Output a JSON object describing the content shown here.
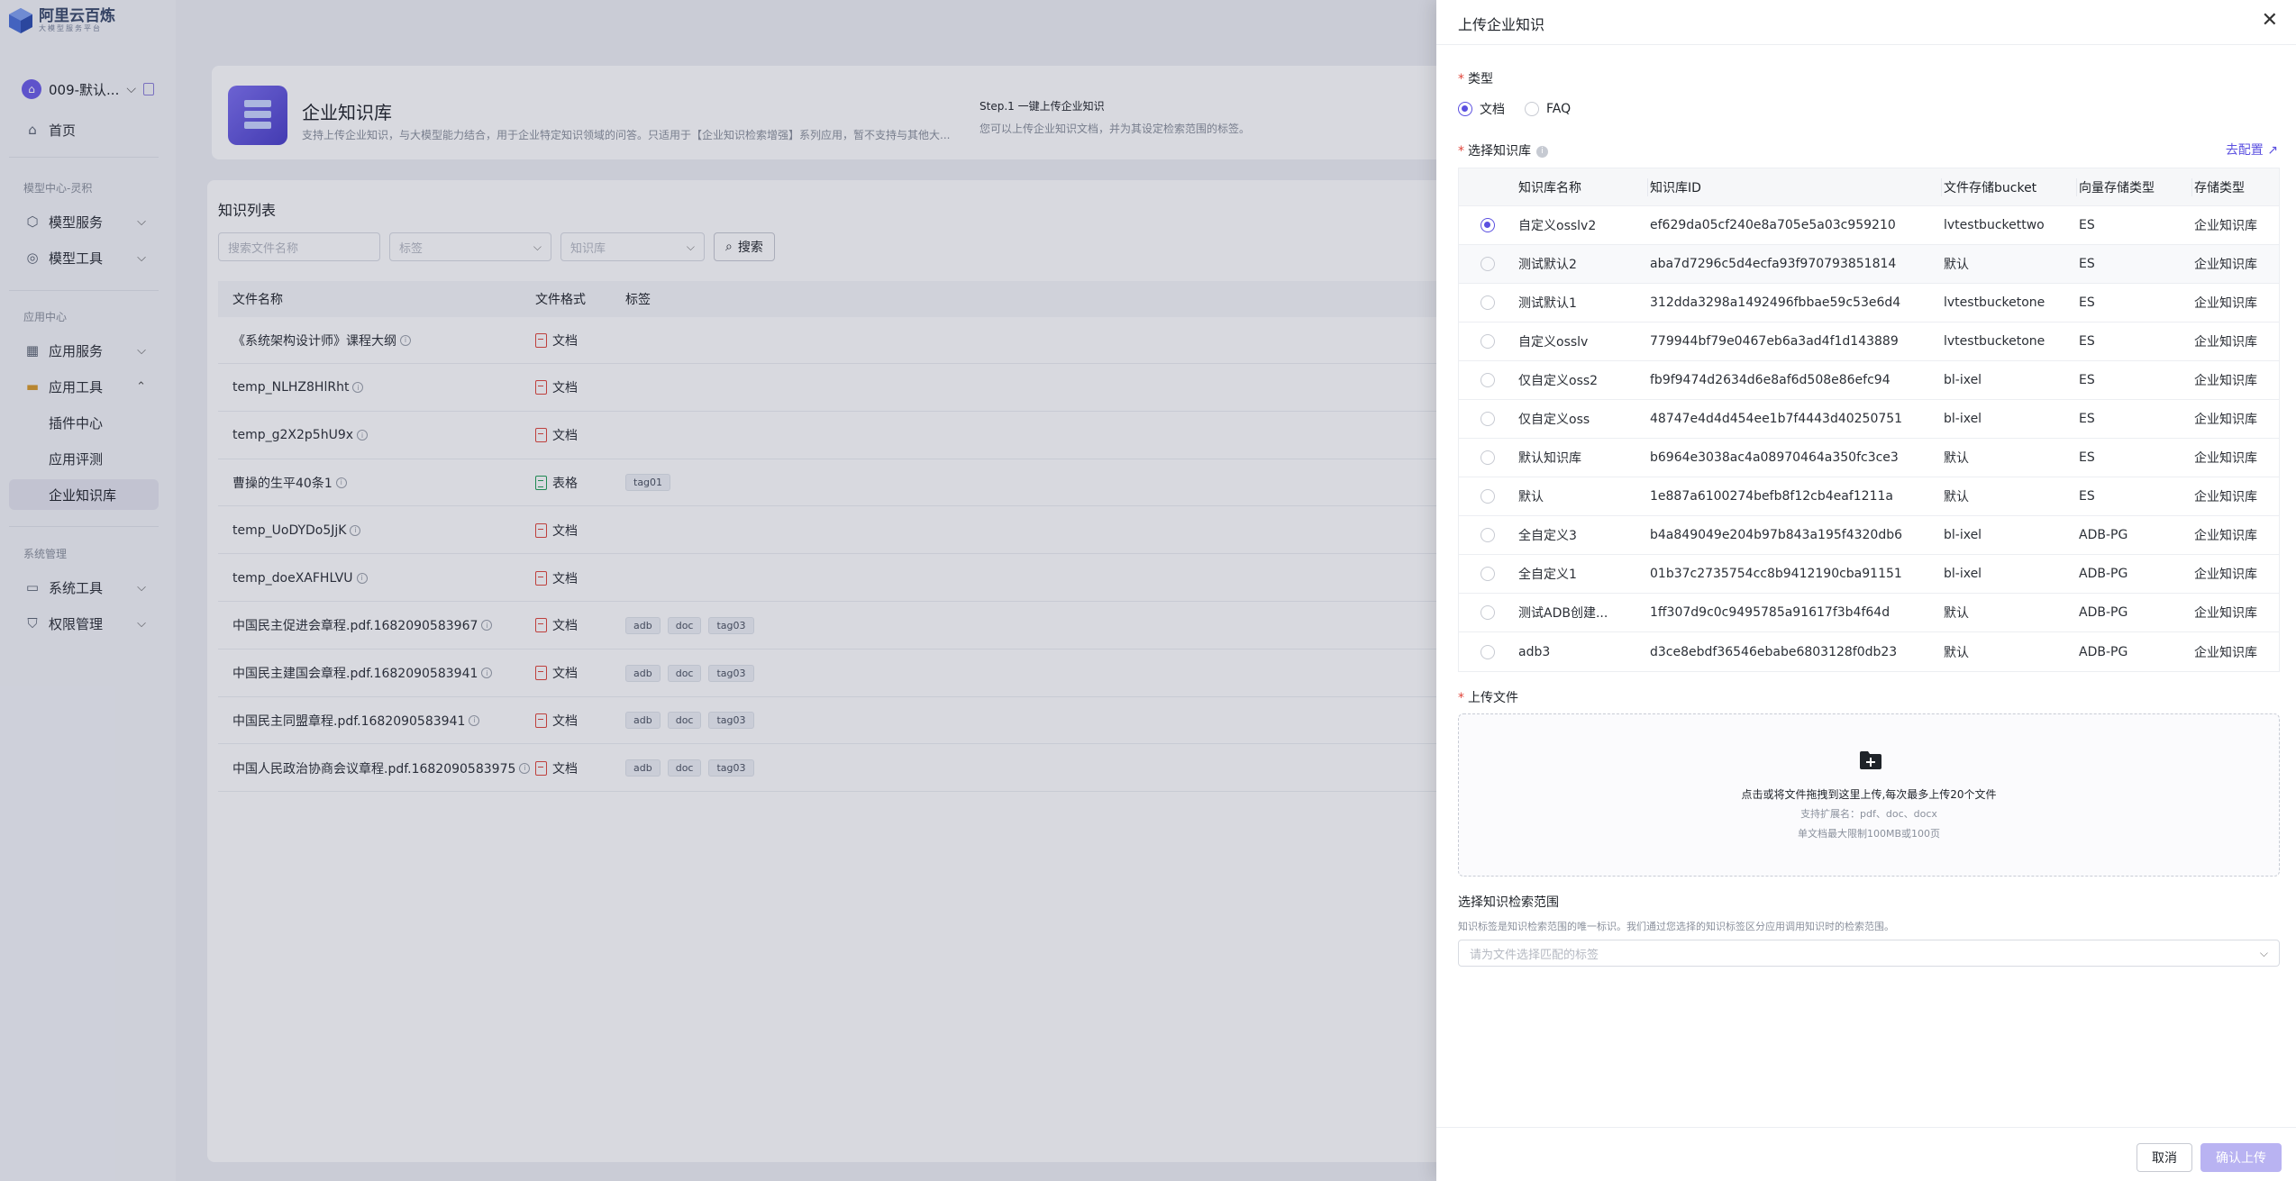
{
  "app": {
    "logo_title": "阿里云百炼",
    "logo_subtitle": "大模型服务平台",
    "brand_color": "#5b50e0"
  },
  "sidebar": {
    "workspace": {
      "avatar": "⌂",
      "name": "009-默认..."
    },
    "home": "首页",
    "section_model": "模型中心-灵积",
    "model_service": "模型服务",
    "model_tools": "模型工具",
    "section_app": "应用中心",
    "app_service": "应用服务",
    "app_tools": "应用工具",
    "sub_plugin": "插件中心",
    "sub_eval": "应用评测",
    "sub_kb": "企业知识库",
    "section_sys": "系统管理",
    "sys_tools": "系统工具",
    "perm_mgmt": "权限管理"
  },
  "banner": {
    "title": "企业知识库",
    "desc": "支持上传企业知识，与大模型能力结合，用于企业特定知识领域的问答。只适用于【企业知识检索增强】系列应用，暂不支持与其他大...",
    "step_title": "Step.1 一键上传企业知识",
    "step_desc": "您可以上传企业知识文档，并为其设定检索范围的标签。"
  },
  "list": {
    "title": "知识列表",
    "search_placeholder": "搜索文件名称",
    "tag_placeholder": "标签",
    "kb_placeholder": "知识库",
    "search_button": "搜索",
    "columns": {
      "name": "文件名称",
      "format": "文件格式",
      "tag": "标签"
    },
    "rows": [
      {
        "name": "《系统架构设计师》课程大纲",
        "format": "文档",
        "icon": "pdf-icon",
        "tags": []
      },
      {
        "name": "temp_NLHZ8HlRht",
        "format": "文档",
        "icon": "pdf-icon",
        "tags": []
      },
      {
        "name": "temp_g2X2p5hU9x",
        "format": "文档",
        "icon": "pdf-icon",
        "tags": []
      },
      {
        "name": "曹操的生平40条1",
        "format": "表格",
        "icon": "sheet-icon",
        "tags": [
          "tag01"
        ]
      },
      {
        "name": "temp_UoDYDo5JjK",
        "format": "文档",
        "icon": "pdf-icon",
        "tags": []
      },
      {
        "name": "temp_doeXAFHLVU",
        "format": "文档",
        "icon": "pdf-icon",
        "tags": []
      },
      {
        "name": "中国民主促进会章程.pdf.1682090583967",
        "format": "文档",
        "icon": "pdf-icon",
        "tags": [
          "adb",
          "doc",
          "tag03"
        ]
      },
      {
        "name": "中国民主建国会章程.pdf.1682090583941",
        "format": "文档",
        "icon": "pdf-icon",
        "tags": [
          "adb",
          "doc",
          "tag03"
        ]
      },
      {
        "name": "中国民主同盟章程.pdf.1682090583941",
        "format": "文档",
        "icon": "pdf-icon",
        "tags": [
          "adb",
          "doc",
          "tag03"
        ]
      },
      {
        "name": "中国人民政治协商会议章程.pdf.1682090583975",
        "format": "文档",
        "icon": "pdf-icon",
        "tags": [
          "adb",
          "doc",
          "tag03"
        ]
      }
    ]
  },
  "drawer": {
    "title": "上传企业知识",
    "type_label": "类型",
    "type_options": [
      "文档",
      "FAQ"
    ],
    "type_selected": "文档",
    "kb_label": "选择知识库",
    "go_config": "去配置",
    "kb_columns": {
      "name": "知识库名称",
      "id": "知识库ID",
      "bucket": "文件存储bucket",
      "vector": "向量存储类型",
      "storage": "存储类型"
    },
    "kb_rows": [
      {
        "name": "自定义osslv2",
        "id": "ef629da05cf240e8a705e5a03c959210",
        "bucket": "lvtestbuckettwo",
        "vector": "ES",
        "storage": "企业知识库",
        "selected": true
      },
      {
        "name": "测试默认2",
        "id": "aba7d7296c5d4ecfa93f970793851814",
        "bucket": "默认",
        "vector": "ES",
        "storage": "企业知识库",
        "selected": false
      },
      {
        "name": "测试默认1",
        "id": "312dda3298a1492496fbbae59c53e6d4",
        "bucket": "lvtestbucketone",
        "vector": "ES",
        "storage": "企业知识库",
        "selected": false
      },
      {
        "name": "自定义osslv",
        "id": "779944bf79e0467eb6a3ad4f1d143889",
        "bucket": "lvtestbucketone",
        "vector": "ES",
        "storage": "企业知识库",
        "selected": false
      },
      {
        "name": "仅自定义oss2",
        "id": "fb9f9474d2634d6e8af6d508e86efc94",
        "bucket": "bl-ixel",
        "vector": "ES",
        "storage": "企业知识库",
        "selected": false
      },
      {
        "name": "仅自定义oss",
        "id": "48747e4d4d454ee1b7f4443d40250751",
        "bucket": "bl-ixel",
        "vector": "ES",
        "storage": "企业知识库",
        "selected": false
      },
      {
        "name": "默认知识库",
        "id": "b6964e3038ac4a08970464a350fc3ce3",
        "bucket": "默认",
        "vector": "ES",
        "storage": "企业知识库",
        "selected": false
      },
      {
        "name": "默认",
        "id": "1e887a6100274befb8f12cb4eaf1211a",
        "bucket": "默认",
        "vector": "ES",
        "storage": "企业知识库",
        "selected": false
      },
      {
        "name": "全自定义3",
        "id": "b4a849049e204b97b843a195f4320db6",
        "bucket": "bl-ixel",
        "vector": "ADB-PG",
        "storage": "企业知识库",
        "selected": false
      },
      {
        "name": "全自定义1",
        "id": "01b37c2735754cc8b9412190cba91151",
        "bucket": "bl-ixel",
        "vector": "ADB-PG",
        "storage": "企业知识库",
        "selected": false
      },
      {
        "name": "测试ADB创建...",
        "id": "1ff307d9c0c9495785a91617f3b4f64d",
        "bucket": "默认",
        "vector": "ADB-PG",
        "storage": "企业知识库",
        "selected": false
      },
      {
        "name": "adb3",
        "id": "d3ce8ebdf36546ebabe6803128f0db23",
        "bucket": "默认",
        "vector": "ADB-PG",
        "storage": "企业知识库",
        "selected": false
      }
    ],
    "upload_label": "上传文件",
    "upload_main": "点击或将文件拖拽到这里上传,每次最多上传20个文件",
    "upload_ext": "支持扩展名：pdf、doc、docx",
    "upload_limit": "单文档最大限制100MB或100页",
    "scope_title": "选择知识检索范围",
    "scope_desc": "知识标签是知识检索范围的唯一标识。我们通过您选择的知识标签区分应用调用知识时的检索范围。",
    "scope_placeholder": "请为文件选择匹配的标签",
    "cancel": "取消",
    "confirm": "确认上传"
  }
}
